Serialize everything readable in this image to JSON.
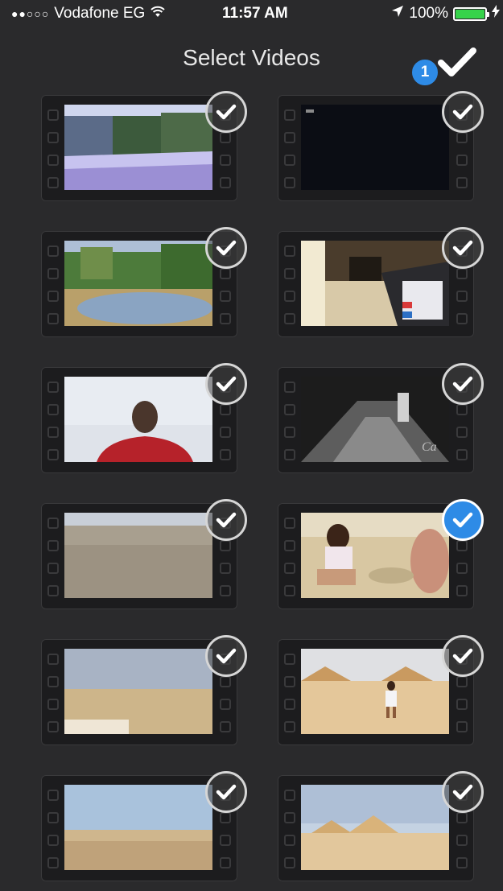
{
  "status_bar": {
    "signal_dots": "●●○○○",
    "carrier": "Vodafone EG",
    "wifi_icon": "wifi-icon",
    "time": "11:57 AM",
    "location_icon": "location-arrow-icon",
    "battery_percent": "100%",
    "battery_level": 1.0,
    "charging_icon": "bolt-icon"
  },
  "nav": {
    "title": "Select Videos",
    "selected_count": "1",
    "done_icon": "checkmark-icon"
  },
  "colors": {
    "accent": "#2e8be6",
    "background": "#2a2a2c",
    "battery_green": "#36d34a"
  },
  "videos": [
    {
      "scene": "courtyard-trees",
      "selected": false
    },
    {
      "scene": "dark-screen",
      "selected": false
    },
    {
      "scene": "garden-path",
      "selected": false
    },
    {
      "scene": "indoor-tablet",
      "selected": false
    },
    {
      "scene": "man-selfie",
      "selected": false
    },
    {
      "scene": "stairs-night",
      "selected": false
    },
    {
      "scene": "sand-ground",
      "selected": false
    },
    {
      "scene": "children-sand",
      "selected": true
    },
    {
      "scene": "desert-plain",
      "selected": false
    },
    {
      "scene": "pyramids-girl",
      "selected": false
    },
    {
      "scene": "desert-horizon",
      "selected": false
    },
    {
      "scene": "pyramids-wide",
      "selected": false
    }
  ]
}
